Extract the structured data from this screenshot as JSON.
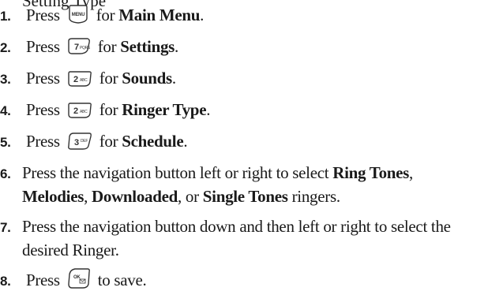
{
  "steps": [
    {
      "num": "1.",
      "pre": "Press",
      "key": "MENU",
      "mid": "for",
      "bold": "Main Menu",
      "post": "."
    },
    {
      "num": "2.",
      "pre": "Press",
      "key": "7PQRS",
      "mid": "for",
      "bold": "Settings",
      "post": "."
    },
    {
      "num": "3.",
      "pre": "Press",
      "key": "2ABC",
      "mid": "for",
      "bold": "Sounds",
      "post": "."
    },
    {
      "num": "4.",
      "pre": "Press",
      "key": "2ABC",
      "mid": "for",
      "bold": "Ringer Type",
      "post": "."
    },
    {
      "num": "5.",
      "pre": "Press",
      "key": "3DEF",
      "mid": "for",
      "bold": "Schedule",
      "post": "."
    },
    {
      "num": "6.",
      "line1a": "Press the navigation button left or right to select ",
      "b1": "Ring Tones",
      "line1b": ",",
      "b2": "Melodies",
      "sep1": ", ",
      "b3": "Downloaded",
      "sep2": ", or ",
      "b4": "Single Tones",
      "line2end": " ringers."
    },
    {
      "num": "7.",
      "line1": "Press the navigation button down and then left or right to select the",
      "line2": "desired Ringer."
    },
    {
      "num": "8.",
      "pre": "Press",
      "key": "OK",
      "post": "to save."
    }
  ],
  "icons": {
    "menu": "menu-key-icon",
    "seven": "key-7-pqrs-icon",
    "two": "key-2-abc-icon",
    "three": "key-3-def-icon",
    "ok": "ok-key-icon"
  },
  "partial_top_text": "Setting Type"
}
